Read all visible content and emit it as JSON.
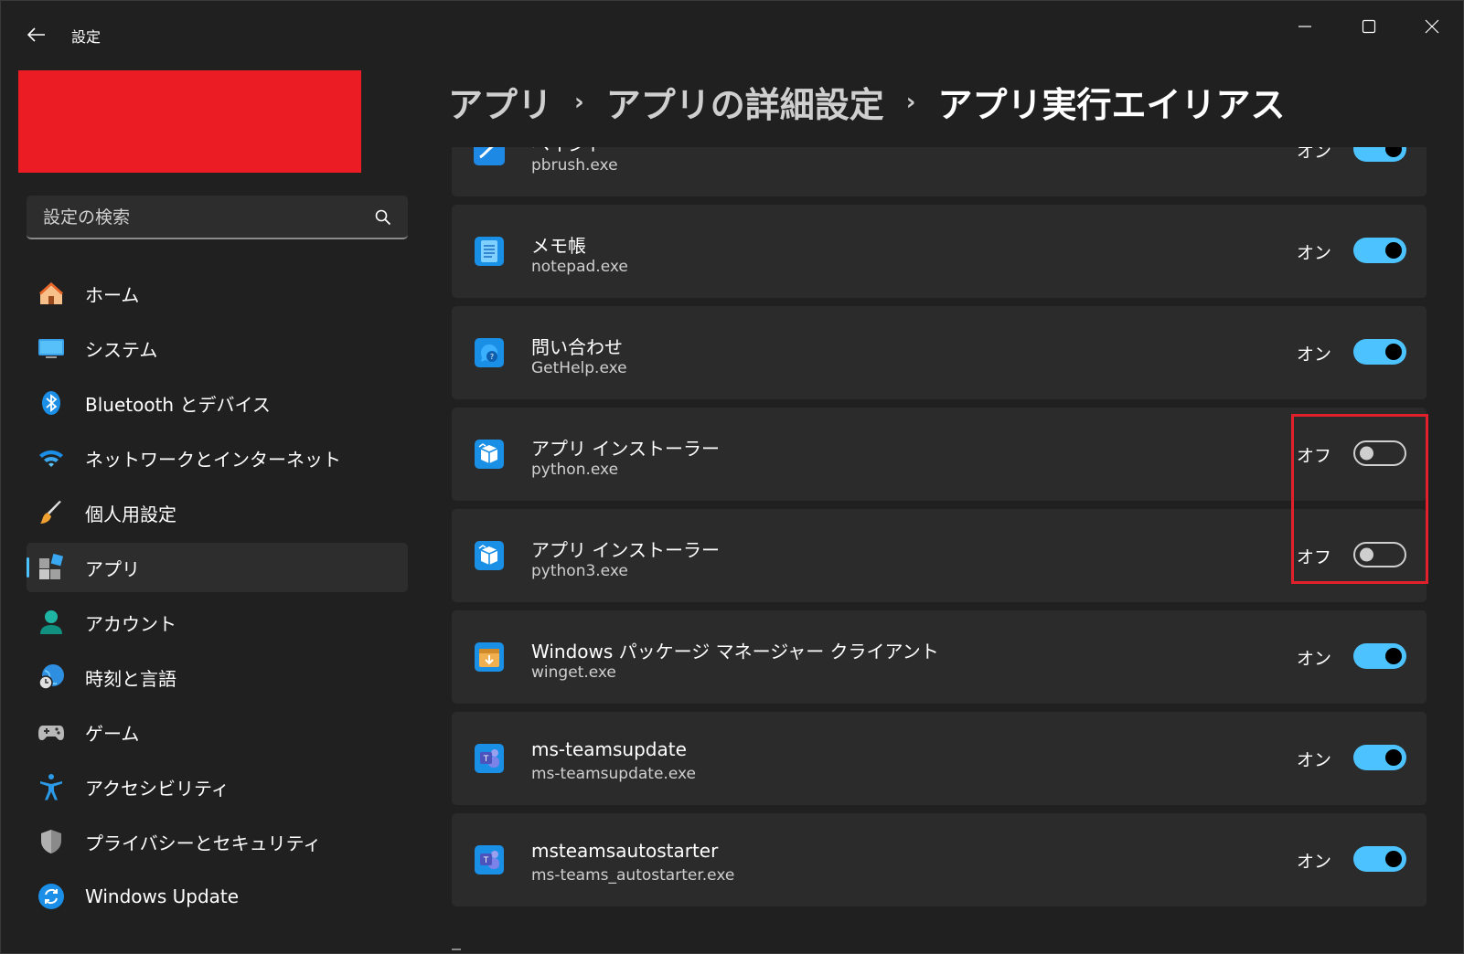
{
  "window": {
    "title": "設定",
    "accent_color": "#4cc2ff",
    "highlight_color": "#e0202a",
    "redaction_color": "#ec1c24"
  },
  "search": {
    "placeholder": "設定の検索"
  },
  "sidebar": {
    "items": [
      {
        "label": "ホーム",
        "icon": "home-icon",
        "active": false
      },
      {
        "label": "システム",
        "icon": "system-icon",
        "active": false
      },
      {
        "label": "Bluetooth とデバイス",
        "icon": "bluetooth-icon",
        "active": false
      },
      {
        "label": "ネットワークとインターネット",
        "icon": "wifi-icon",
        "active": false
      },
      {
        "label": "個人用設定",
        "icon": "brush-icon",
        "active": false
      },
      {
        "label": "アプリ",
        "icon": "apps-icon",
        "active": true
      },
      {
        "label": "アカウント",
        "icon": "account-icon",
        "active": false
      },
      {
        "label": "時刻と言語",
        "icon": "time-language-icon",
        "active": false
      },
      {
        "label": "ゲーム",
        "icon": "gamepad-icon",
        "active": false
      },
      {
        "label": "アクセシビリティ",
        "icon": "accessibility-icon",
        "active": false
      },
      {
        "label": "プライバシーとセキュリティ",
        "icon": "shield-icon",
        "active": false
      },
      {
        "label": "Windows Update",
        "icon": "update-icon",
        "active": false
      }
    ]
  },
  "breadcrumb": {
    "items": [
      "アプリ",
      "アプリの詳細設定",
      "アプリ実行エイリアス"
    ]
  },
  "aliases": [
    {
      "title": "ペイント",
      "exe": "pbrush.exe",
      "state": "オン",
      "on": true,
      "icon": "paint-icon"
    },
    {
      "title": "メモ帳",
      "exe": "notepad.exe",
      "state": "オン",
      "on": true,
      "icon": "notepad-icon"
    },
    {
      "title": "問い合わせ",
      "exe": "GetHelp.exe",
      "state": "オン",
      "on": true,
      "icon": "gethelp-icon"
    },
    {
      "title": "アプリ インストーラー",
      "exe": "python.exe",
      "state": "オフ",
      "on": false,
      "icon": "app-installer-icon"
    },
    {
      "title": "アプリ インストーラー",
      "exe": "python3.exe",
      "state": "オフ",
      "on": false,
      "icon": "app-installer-icon"
    },
    {
      "title": "Windows パッケージ マネージャー クライアント",
      "exe": "winget.exe",
      "state": "オン",
      "on": true,
      "icon": "winget-icon"
    },
    {
      "title": "ms-teamsupdate",
      "exe": "ms-teamsupdate.exe",
      "state": "オン",
      "on": true,
      "icon": "teams-icon"
    },
    {
      "title": "msteamsautostarter",
      "exe": "ms-teams_autostarter.exe",
      "state": "オン",
      "on": true,
      "icon": "teams-icon"
    }
  ]
}
